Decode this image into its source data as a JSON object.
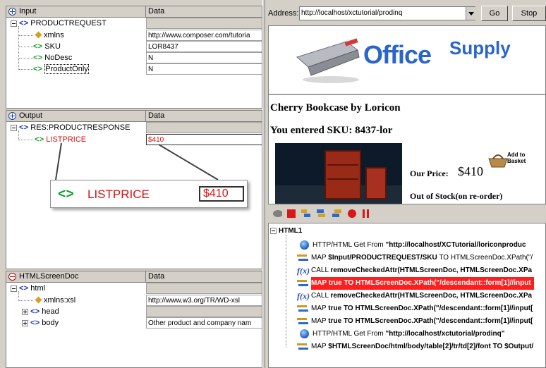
{
  "input_panel": {
    "title": "Input",
    "data_header": "Data",
    "root": "PRODUCTREQUEST",
    "rows": [
      {
        "name": "xmlns",
        "value": "http://www.composer.com/tutoria"
      },
      {
        "name": "SKU",
        "value": "LOR8437"
      },
      {
        "name": "NoDesc",
        "value": "N"
      },
      {
        "name": "ProductOnly",
        "value": "N"
      }
    ]
  },
  "output_panel": {
    "title": "Output",
    "data_header": "Data",
    "root": "RES:PRODUCTRESPONSE",
    "field": "LISTPRICE",
    "value": "$410",
    "callout_field": "LISTPRICE",
    "callout_value": "$410"
  },
  "html_panel": {
    "title": "HTMLScreenDoc",
    "data_header": "Data",
    "root": "html",
    "rows": [
      {
        "name": "xmlns:xsl",
        "value": "http://www.w3.org/TR/WD-xsl"
      },
      {
        "name": "head",
        "value": ""
      },
      {
        "name": "body",
        "value": "Other product and company nam"
      }
    ]
  },
  "browser": {
    "address_label": "Address:",
    "address_value": "http://localhost/xctutorial/prodinq",
    "go_label": "Go",
    "stop_label": "Stop",
    "logo_office": "Office",
    "logo_supply": "Supply",
    "product_title": "Cherry Bookcase by Loricon",
    "sku_line": "You entered SKU: 8437-lor",
    "price_label": "Our Price:",
    "price_value": "$410",
    "add_to_basket": "Add to Basket",
    "stock_status": "Out of Stock(on re-order)"
  },
  "actions_tree": {
    "root": "HTML1",
    "rows": [
      {
        "type": "get",
        "prefix": "HTTP/HTML Get From ",
        "bold": "\"http://localhost/XCTutorial/loriconproduc",
        "rest": ""
      },
      {
        "type": "map",
        "prefix": "MAP ",
        "bold": "$Input/PRODUCTREQUEST/SKU",
        "rest": " TO HTMLScreenDoc.XPath(\"/"
      },
      {
        "type": "call",
        "prefix": "CALL ",
        "bold": "removeCheckedAttr(HTMLScreenDoc, HTMLScreenDoc.XPa",
        "rest": ""
      },
      {
        "type": "map",
        "prefix": "MAP true TO HTMLScreenDoc.XPath(\"/descendant::form[1]//input",
        "bold": "",
        "rest": "",
        "highlight": true
      },
      {
        "type": "call",
        "prefix": "CALL ",
        "bold": "removeCheckedAttr(HTMLScreenDoc, HTMLScreenDoc.XPa",
        "rest": ""
      },
      {
        "type": "map",
        "prefix": "MAP ",
        "bold": "true",
        "rest": " TO HTMLScreenDoc.XPath(\"/descendant::form[1]//input["
      },
      {
        "type": "map",
        "prefix": "MAP ",
        "bold": "true",
        "rest": " TO HTMLScreenDoc.XPath(\"/descendant::form[1]//input["
      },
      {
        "type": "get",
        "prefix": "HTTP/HTML Get From ",
        "bold": "\"http://localhost/xctutorial/prodinq\"",
        "rest": ""
      },
      {
        "type": "map",
        "prefix": "MAP ",
        "bold": "$HTMLScreenDoc/html/body/table[2]/tr/td[2]/font",
        "rest": " TO $Output/"
      }
    ]
  },
  "colors": {
    "tag_blue": "#1a2fb8",
    "tag_green": "#0f9f2a",
    "highlight": "#ff1e1e",
    "logo_blue": "#2a66c8"
  }
}
